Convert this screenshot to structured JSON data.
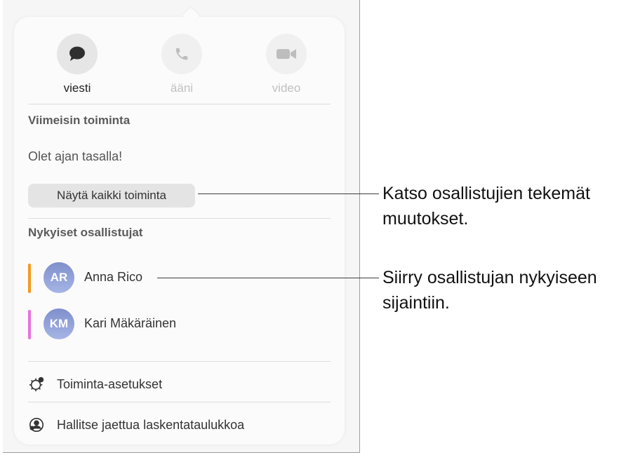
{
  "actions": [
    {
      "label": "viesti",
      "icon": "message-bubble-icon",
      "active": true
    },
    {
      "label": "ääni",
      "icon": "phone-icon",
      "active": false
    },
    {
      "label": "video",
      "icon": "video-camera-icon",
      "active": false
    }
  ],
  "recent": {
    "heading": "Viimeisin toiminta",
    "status": "Olet ajan tasalla!",
    "show_all_button": "Näytä kaikki toiminta"
  },
  "participants": {
    "heading": "Nykyiset osallistujat",
    "items": [
      {
        "initials": "AR",
        "name": "Anna Rico",
        "color": "#f39a1e"
      },
      {
        "initials": "KM",
        "name": "Kari Mäkäräinen",
        "color": "#ea72dd"
      }
    ]
  },
  "menu": [
    {
      "label": "Toiminta-asetukset",
      "icon": "activity-settings-icon"
    },
    {
      "label": "Hallitse jaettua laskentataulukkoa",
      "icon": "manage-shared-icon"
    }
  ],
  "callouts": [
    {
      "text": "Katso osallistujien tekemät muutokset."
    },
    {
      "text": "Siirry osallistujan nykyiseen sijaintiin."
    }
  ]
}
